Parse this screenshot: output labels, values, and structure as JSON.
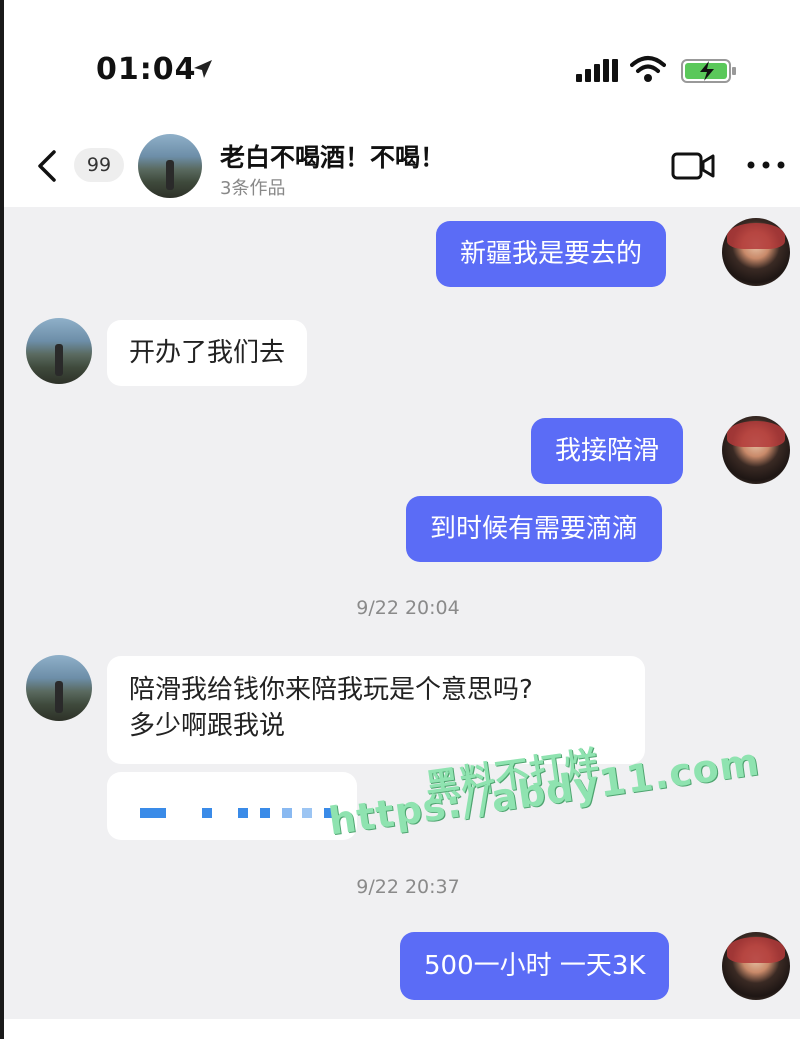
{
  "status_bar": {
    "time": "01:04",
    "icons": [
      "location-arrow-icon",
      "signal-icon",
      "wifi-icon",
      "battery-charging-icon"
    ]
  },
  "header": {
    "back_icon": "chevron-left-icon",
    "unread_count": "99",
    "contact_name": "老白不喝酒！不喝！",
    "contact_subtitle": "3条作品",
    "actions": [
      "video-call-icon",
      "more-icon"
    ]
  },
  "messages": [
    {
      "side": "out",
      "text": "新疆我是要去的"
    },
    {
      "side": "in",
      "text": "开办了我们去"
    },
    {
      "side": "out",
      "text": "我接陪滑"
    },
    {
      "side": "out",
      "text": "到时候有需要滴滴"
    },
    {
      "side": "time",
      "text": "9/22 20:04"
    },
    {
      "side": "in",
      "line1": "陪滑我给钱你来陪我玩是个意思吗?",
      "line2": "多少啊跟我说"
    },
    {
      "side": "time",
      "text": "9/22 20:37"
    },
    {
      "side": "out",
      "text": "500一小时 一天3K"
    }
  ],
  "watermark": {
    "line1": "黑料不打烊",
    "line2": "https://abdy11.com"
  },
  "colors": {
    "outgoing_bubble": "#5b6cf6",
    "incoming_bubble": "#ffffff",
    "chat_background": "#f0f0f2",
    "watermark": "#8fe3b0"
  }
}
